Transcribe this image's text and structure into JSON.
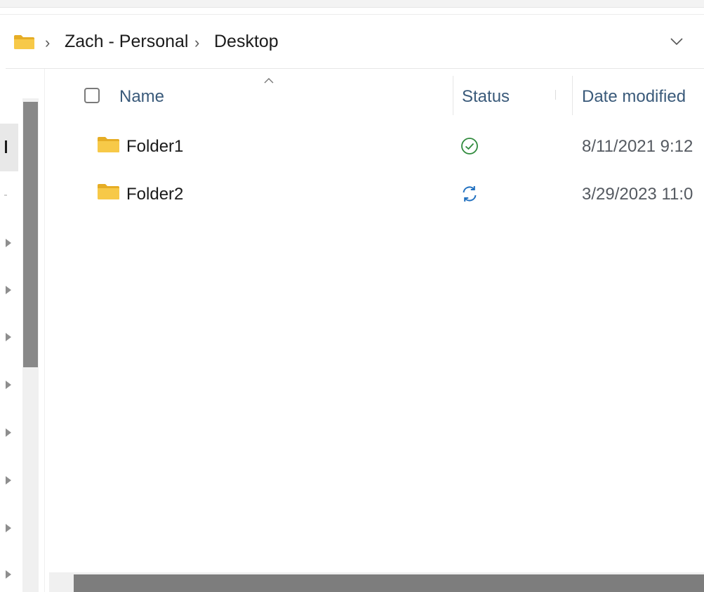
{
  "breadcrumb": {
    "items": [
      "Zach - Personal",
      "Desktop"
    ]
  },
  "columns": {
    "name": "Name",
    "status": "Status",
    "date_modified": "Date modified"
  },
  "rows": [
    {
      "name": "Folder1",
      "status": "synced",
      "date": "8/11/2021 9:12"
    },
    {
      "name": "Folder2",
      "status": "syncing",
      "date": "3/29/2023 11:0"
    }
  ],
  "colors": {
    "folder": "#f7c948",
    "synced": "#2f8a3c",
    "syncing": "#1f6fbf"
  }
}
